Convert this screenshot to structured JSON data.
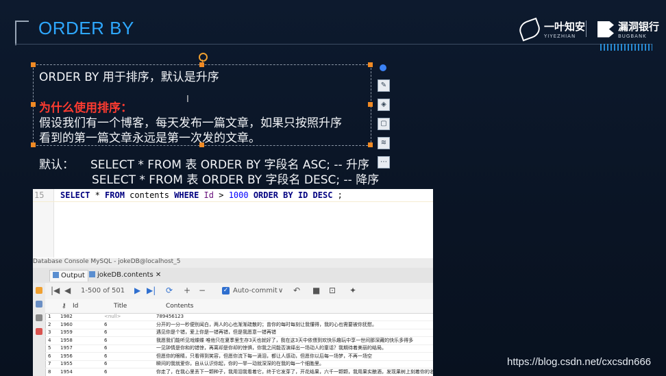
{
  "slide": {
    "title": "ORDER BY",
    "logos": {
      "a_text": "一叶知安",
      "a_sub": "YIYEZHIAN",
      "b_text": "漏洞银行",
      "b_sub": "BUGBANK"
    },
    "textbox": {
      "line1": "ORDER BY 用于排序，默认是升序",
      "line2": "为什么使用排序：",
      "line3": "假设我们有一个博客，每天发布一篇文章，如果只按照升序",
      "line4": "看到的第一篇文章永远是第一次发的文章。"
    },
    "default_label": "默认：",
    "sql_asc": "SELECT * FROM 表 ORDER BY  字段名 ASC; -- 升序",
    "sql_desc": "SELECT * FROM 表 ORDER BY 字段名 DESC; -- 降序",
    "watermark": "https://blog.csdn.net/cxcsdn666"
  },
  "ide": {
    "line_number": "15",
    "code": {
      "select": "SELECT",
      "star": " * ",
      "from": "FROM",
      "table": " contents ",
      "where": "WHERE",
      "col": " Id ",
      "op": "> ",
      "value": "1000",
      "order": " ORDER BY ",
      "orderid": "ID ",
      "desc": "DESC",
      "end": " ;"
    },
    "console_title": "Database Console MySQL - jokeDB@localhost_5",
    "tabs": [
      "Output",
      "jokeDB.contents"
    ],
    "pager": "1-500 of 501",
    "autocommit": "Auto-commit",
    "columns": [
      "Id",
      "Title",
      "Contents"
    ],
    "rows": [
      {
        "n": "1",
        "id": "1982",
        "title": "<null>",
        "content": "789456123"
      },
      {
        "n": "2",
        "id": "1960",
        "title": "6",
        "content": "分开的一分一秒便别闻白，两人的心也渐渐疏散的；曾你的每时每刻让我懂得，我的心也需要被你抚慰。"
      },
      {
        "n": "3",
        "id": "1959",
        "title": "6",
        "content": "遇见你是个错，爱上你是一错再错，但是我愿意一错再错"
      },
      {
        "n": "4",
        "id": "1958",
        "title": "6",
        "content": "我愿我们能听见戏蝶蝶 唯他只在夏季里生存3天也就好了，我在这3天中依偎到欢快乐趣玩中享一世间那深藏的快乐多得多"
      },
      {
        "n": "5",
        "id": "1957",
        "id2": "",
        "title": "6",
        "content": "一见钟情是你和的错惊，再离却是你却的惊惧，你我之间能否演绎出一场动人的童话？我期待着美丽的结局。"
      },
      {
        "n": "6",
        "id": "1956",
        "title": "6",
        "content": "但愿你的眼睛，只看得到笑容，但愿你流下每一滴泪，都让人感动，但愿你以后每一场梦，不再一场空"
      },
      {
        "n": "7",
        "id": "1955",
        "title": "6",
        "content": "瞬间的我就爱你，自从认识你起，你的一举一动就深深的在我的每一个细胞里。"
      },
      {
        "n": "8",
        "id": "1954",
        "title": "6",
        "content": "你走了，在我心里丢下一颗种子，我用泪我看着它，终于它发芽了，开花结果，六千一颗颗，我用果实酿酒，发现果树上刻着你的名字"
      }
    ]
  }
}
